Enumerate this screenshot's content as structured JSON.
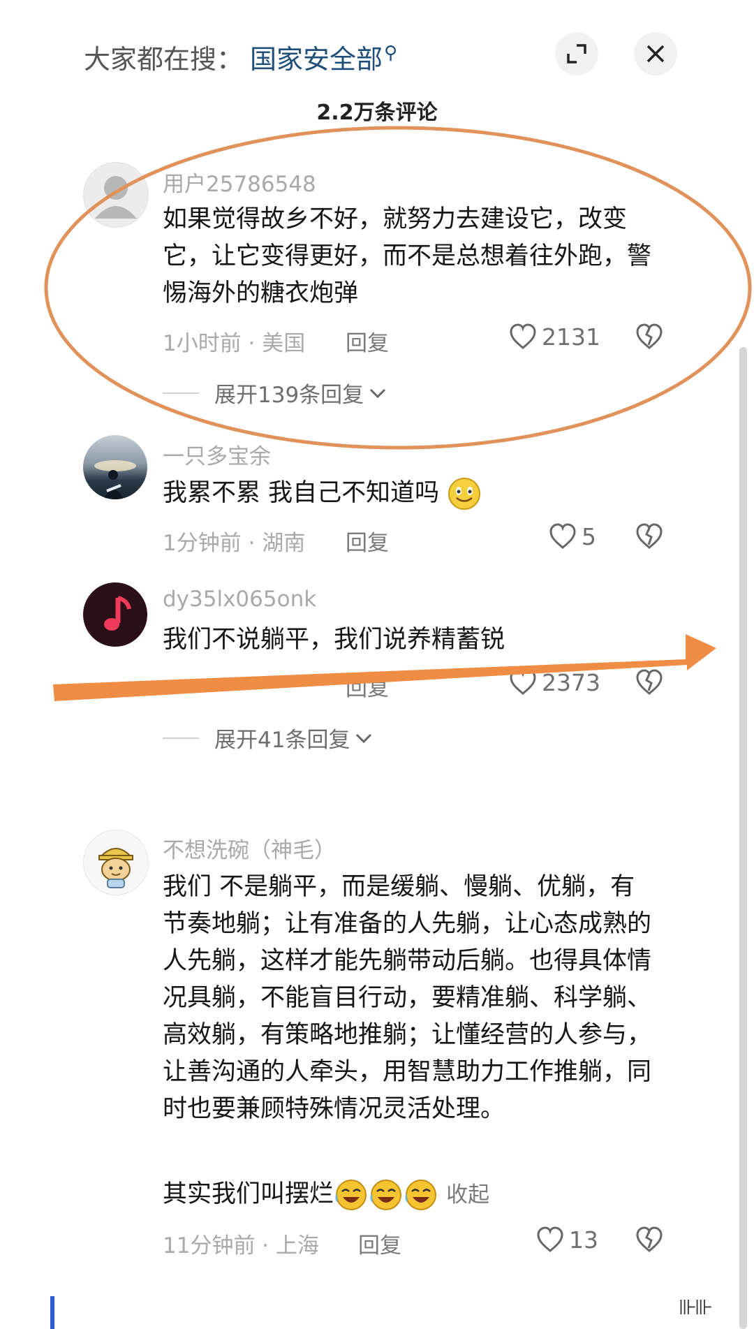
{
  "header": {
    "search_prefix": "大家都在搜：",
    "search_term": "国家安全部",
    "comment_count": "2.2万条评论"
  },
  "comments": [
    {
      "username": "用户25786548",
      "text": "如果觉得故乡不好，就努力去建设它，改变它，让它变得更好，而不是总想着往外跑，警惕海外的糖衣炮弹",
      "time": "1小时前",
      "location": "美国",
      "reply_label": "回复",
      "likes": "2131",
      "expand_label": "展开139条回复"
    },
    {
      "username": "一只多宝余",
      "text": "我累不累 我自己不知道吗",
      "time": "1分钟前",
      "location": "湖南",
      "reply_label": "回复",
      "likes": "5"
    },
    {
      "username": "dy35lx065onk",
      "text": "我们不说躺平，我们说养精蓄锐",
      "reply_label": "回复",
      "likes": "2373",
      "expand_label": "展开41条回复"
    },
    {
      "username": "不想洗碗（神毛）",
      "text": "我们 不是躺平，而是缓躺、慢躺、优躺，有节奏地躺；让有准备的人先躺，让心态成熟的人先躺，这样才能先躺带动后躺。也得具体情况具躺，不能盲目行动，要精准躺、科学躺、高效躺，有策略地推躺；让懂经营的人参与，让善沟通的人牵头，用智慧助力工作推躺，同时也要兼顾特殊情况灵活处理。",
      "text_last": "其实我们叫摆烂",
      "collapse_label": "收起",
      "time": "11分钟前",
      "location": "上海",
      "reply_label": "回复",
      "likes": "13"
    }
  ],
  "annotation_colors": {
    "ellipse": "#e0925a",
    "arrow": "#ef8d45"
  },
  "watermark": "⊪⊪"
}
